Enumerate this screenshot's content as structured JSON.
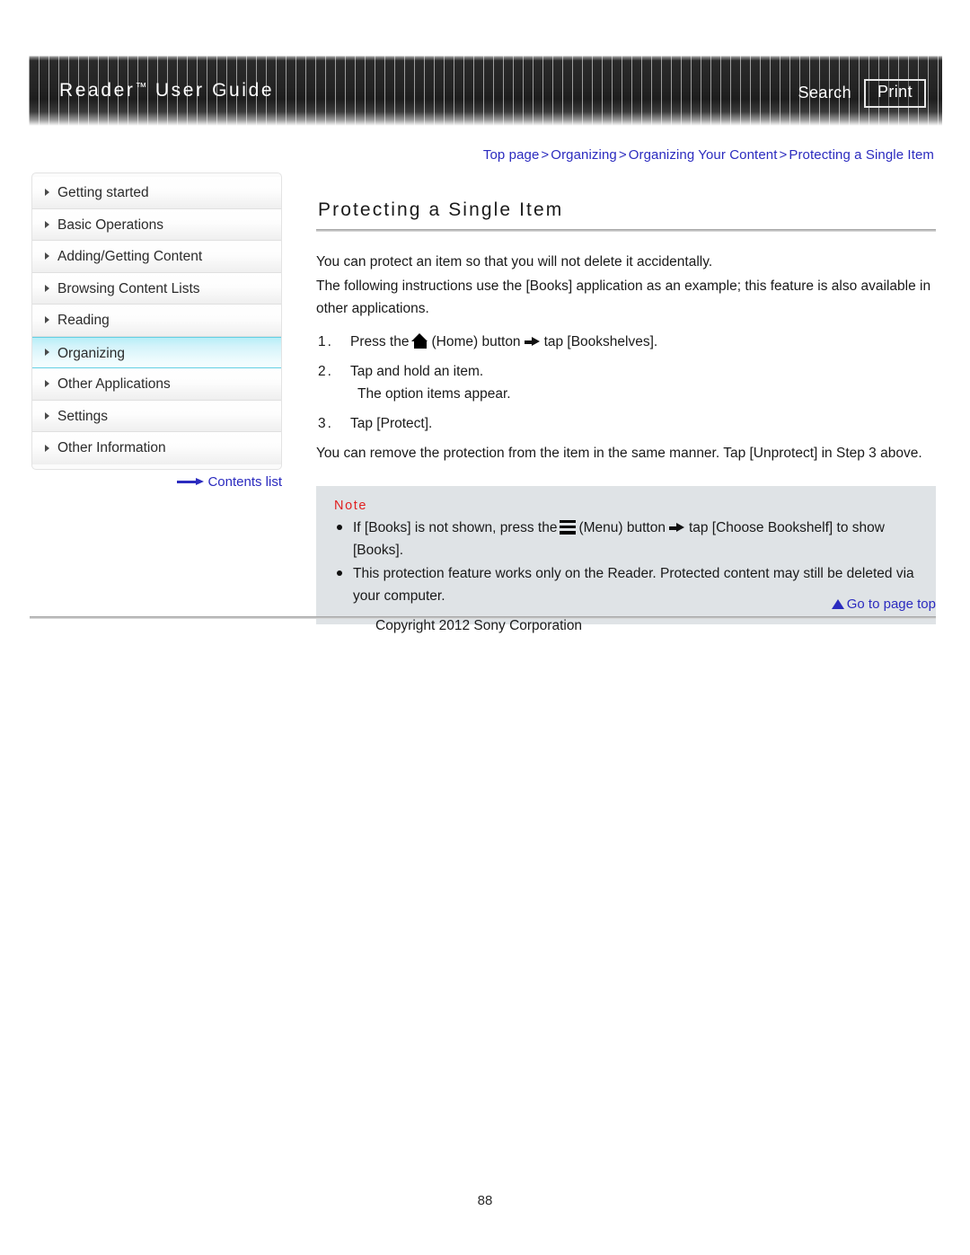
{
  "header": {
    "title_main": "Reader",
    "title_tm": "™",
    "title_rest": " User Guide",
    "search_label": "Search",
    "print_label": "Print"
  },
  "breadcrumb": {
    "items": [
      "Top page",
      "Organizing",
      "Organizing Your Content",
      "Protecting a Single Item"
    ],
    "separator": ">"
  },
  "sidebar": {
    "items": [
      {
        "label": "Getting started",
        "active": false
      },
      {
        "label": "Basic Operations",
        "active": false
      },
      {
        "label": "Adding/Getting Content",
        "active": false
      },
      {
        "label": "Browsing Content Lists",
        "active": false
      },
      {
        "label": "Reading",
        "active": false
      },
      {
        "label": "Organizing",
        "active": true
      },
      {
        "label": "Other Applications",
        "active": false
      },
      {
        "label": "Settings",
        "active": false
      },
      {
        "label": "Other Information",
        "active": false
      }
    ],
    "contents_list_label": "Contents list"
  },
  "main": {
    "page_title": "Protecting a Single Item",
    "intro_1": "You can protect an item so that you will not delete it accidentally.",
    "intro_2": "The following instructions use the [Books] application as an example; this feature is also available in other applications.",
    "steps": [
      {
        "num": "1.",
        "text_before": "Press the",
        "icon": "home-icon",
        "text_mid": "(Home) button",
        "arrow": "arrow-right-icon",
        "text_after": "tap [Bookshelves].",
        "sub": ""
      },
      {
        "num": "2.",
        "text_before": "Tap and hold an item.",
        "icon": "",
        "text_mid": "",
        "arrow": "",
        "text_after": "",
        "sub": "The option items appear."
      },
      {
        "num": "3.",
        "text_before": "Tap [Protect].",
        "icon": "",
        "text_mid": "",
        "arrow": "",
        "text_after": "",
        "sub": ""
      }
    ],
    "after_steps": "You can remove the protection from the item in the same manner. Tap [Unprotect] in Step 3 above."
  },
  "note": {
    "label": "Note",
    "item1_before": "If [Books] is not shown, press the",
    "item1_icon": "menu-icon",
    "item1_mid": "(Menu) button",
    "item1_arrow": "arrow-right-icon",
    "item1_after": "tap [Choose Bookshelf] to show [Books].",
    "item2": "This protection feature works only on the Reader. Protected content may still be deleted via your computer."
  },
  "footer": {
    "go_to_top_label": "Go to page top",
    "copyright": "Copyright 2012 Sony Corporation",
    "page_number": "88"
  },
  "colors": {
    "link": "#2b2bbf",
    "note_label": "#e02020",
    "note_bg": "#dfe3e6",
    "active_nav": "#b6eef7"
  }
}
